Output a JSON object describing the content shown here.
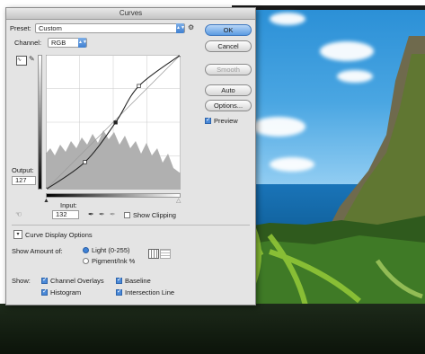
{
  "dialog": {
    "title": "Curves",
    "preset_label": "Preset:",
    "preset_value": "Custom",
    "channel_label": "Channel:",
    "channel_value": "RGB",
    "output_label": "Output:",
    "output_value": "127",
    "input_label": "Input:",
    "input_value": "132",
    "show_clipping_label": "Show Clipping",
    "curve_display_options_label": "Curve Display Options",
    "show_amount_label": "Show Amount of:",
    "light_label": "Light  (0-255)",
    "pigment_label": "Pigment/Ink %",
    "show_label": "Show:",
    "channel_overlays_label": "Channel Overlays",
    "baseline_label": "Baseline",
    "histogram_label": "Histogram",
    "intersection_line_label": "Intersection Line",
    "preview_label": "Preview"
  },
  "buttons": {
    "ok": "OK",
    "cancel": "Cancel",
    "smooth": "Smooth",
    "auto": "Auto",
    "options": "Options..."
  },
  "state": {
    "light_selected": true,
    "show_clipping": false,
    "channel_overlays": true,
    "baseline": true,
    "histogram": true,
    "intersection_line": true,
    "preview": true
  },
  "curve": {
    "input_range": [
      0,
      255
    ],
    "output_range": [
      0,
      255
    ],
    "points": [
      [
        0,
        0
      ],
      [
        74,
        52
      ],
      [
        132,
        127
      ],
      [
        176,
        196
      ],
      [
        255,
        255
      ]
    ]
  },
  "colors": {
    "dialog_bg": "#e4e4e4",
    "accent": "#4a89d8",
    "curve": "#222222"
  },
  "icons": {
    "curve_edit": "curve-edit-icon",
    "pencil": "pencil-icon",
    "eyedroppers": [
      "black-eyedropper-icon",
      "gray-eyedropper-icon",
      "white-eyedropper-icon"
    ],
    "on_image": "on-image-adjust-icon",
    "grid_options": [
      "simple-grid-icon",
      "detailed-grid-icon"
    ]
  }
}
